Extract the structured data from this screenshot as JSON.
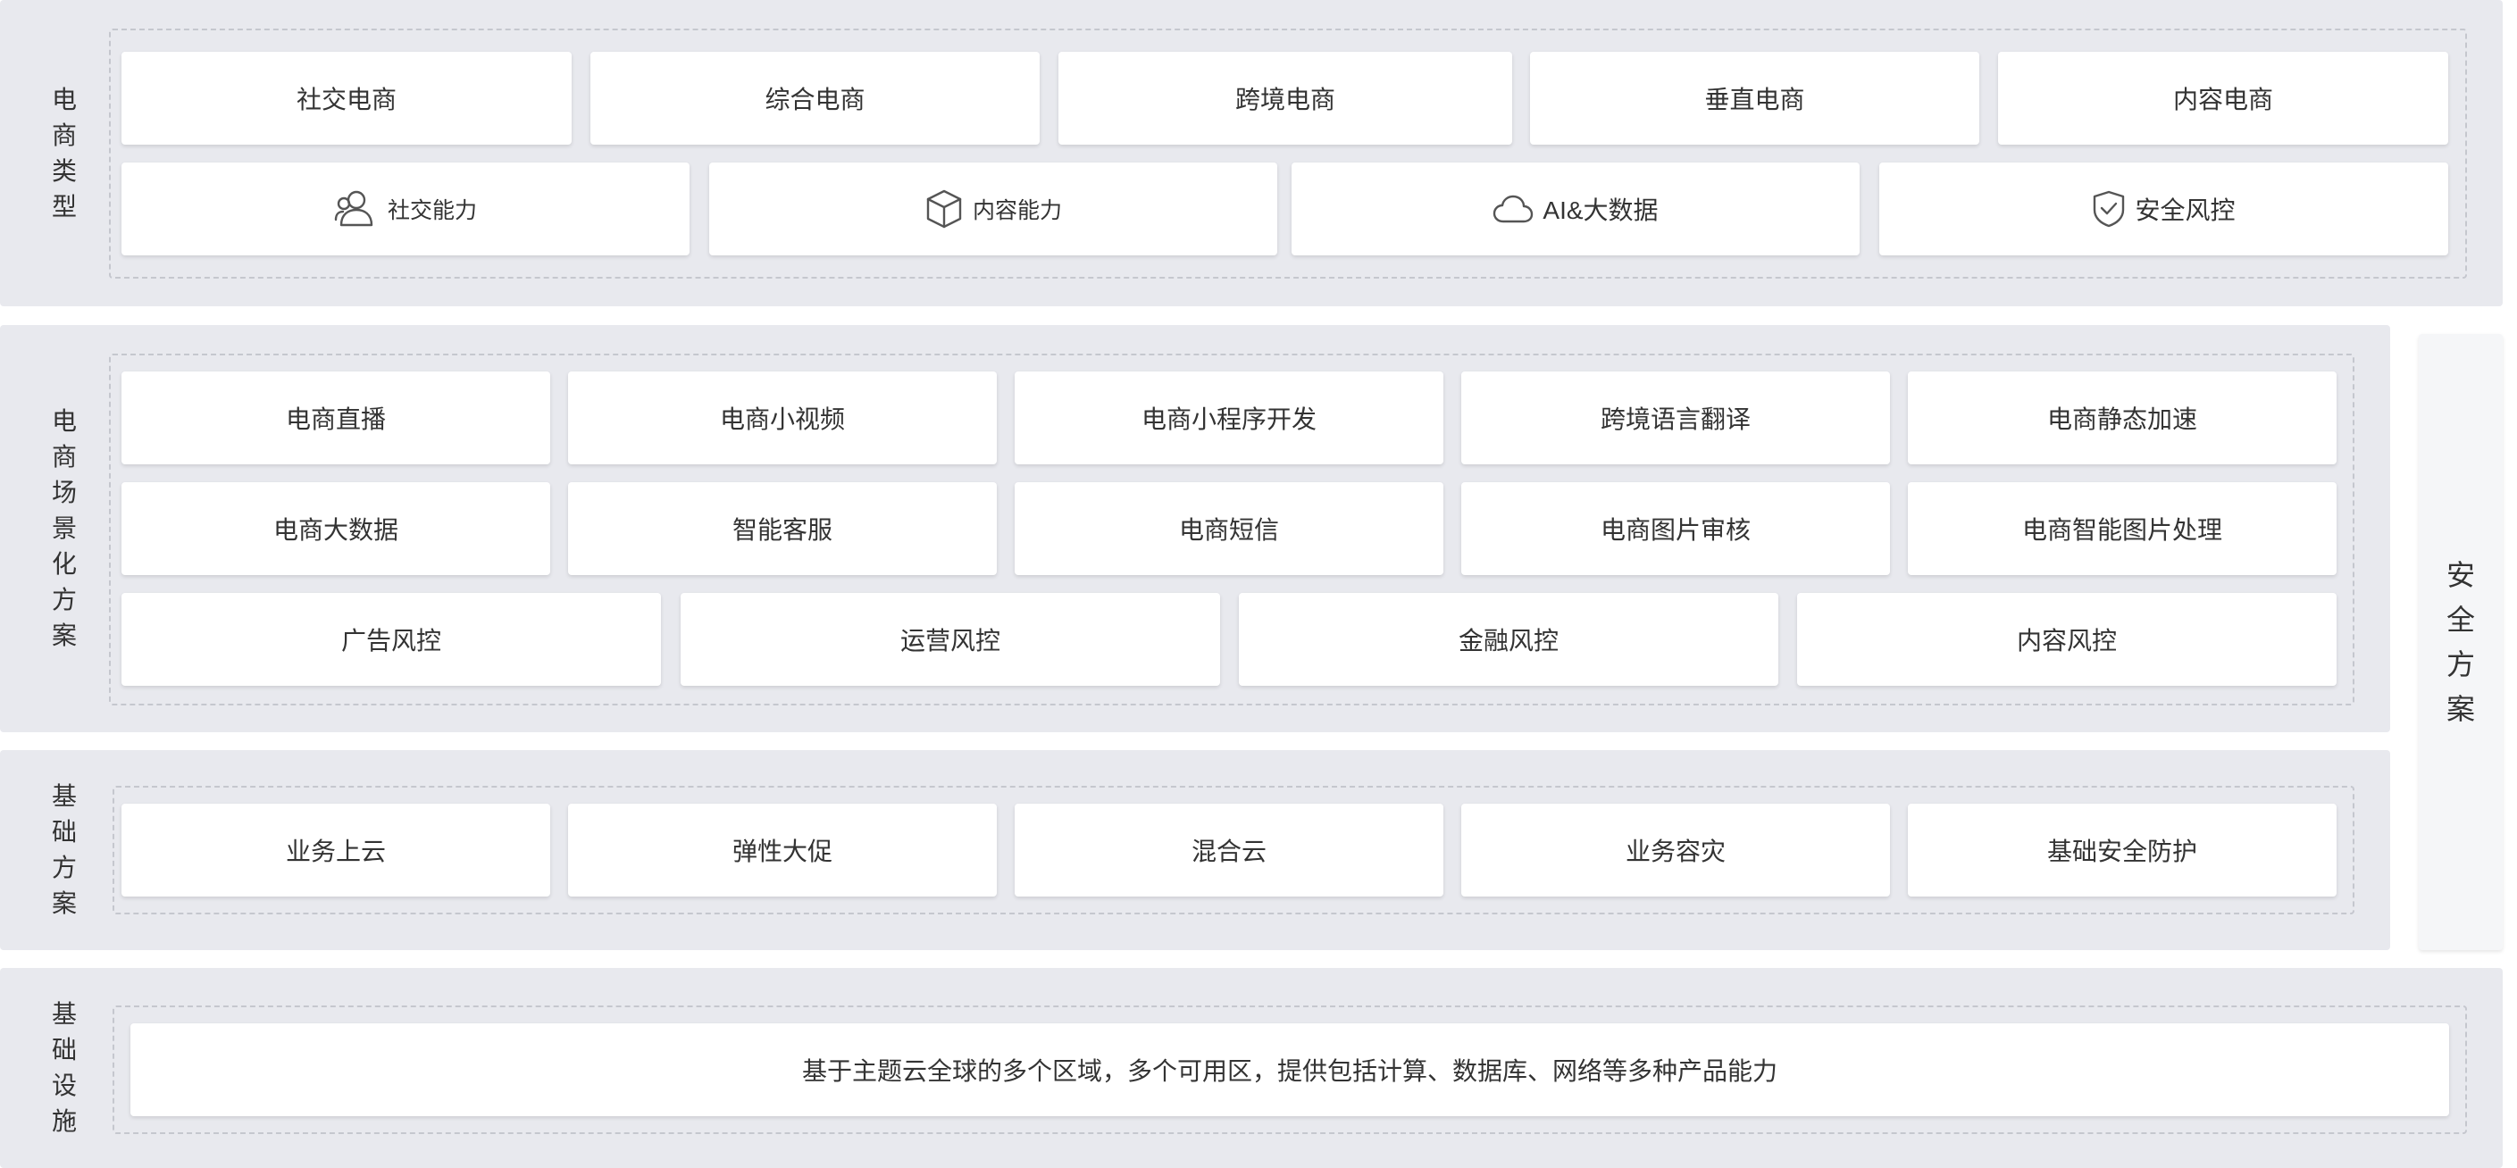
{
  "sections": {
    "ecommerce_types": {
      "title_chars": [
        "电",
        "商",
        "类",
        "型"
      ],
      "row1": [
        "社交电商",
        "综合电商",
        "跨境电商",
        "垂直电商",
        "内容电商"
      ],
      "row2": [
        {
          "label": "社交能力",
          "icon": "users-icon"
        },
        {
          "label": "内容能力",
          "icon": "cube-icon"
        },
        {
          "label": "AI&大数据",
          "icon": "cloud-icon"
        },
        {
          "label": "安全风控",
          "icon": "shield-check-icon"
        }
      ]
    },
    "scenario_solutions": {
      "title_chars": [
        "电",
        "商",
        "场",
        "景",
        "化",
        "方",
        "案"
      ],
      "row1": [
        "电商直播",
        "电商小视频",
        "电商小程序开发",
        "跨境语言翻译",
        "电商静态加速"
      ],
      "row2": [
        "电商大数据",
        "智能客服",
        "电商短信",
        "电商图片审核",
        "电商智能图片处理"
      ],
      "row3": [
        "广告风控",
        "运营风控",
        "金融风控",
        "内容风控"
      ]
    },
    "basic_solutions": {
      "title_chars": [
        "基",
        "础",
        "方",
        "案"
      ],
      "row1": [
        "业务上云",
        "弹性大促",
        "混合云",
        "业务容灾",
        "基础安全防护"
      ]
    },
    "infrastructure": {
      "title_chars": [
        "基",
        "础",
        "设",
        "施"
      ],
      "description": "基于主题云全球的多个区域，多个可用区，提供包括计算、数据库、网络等多种产品能力"
    },
    "security": {
      "title_chars": [
        "安",
        "全",
        "方",
        "案"
      ]
    }
  }
}
